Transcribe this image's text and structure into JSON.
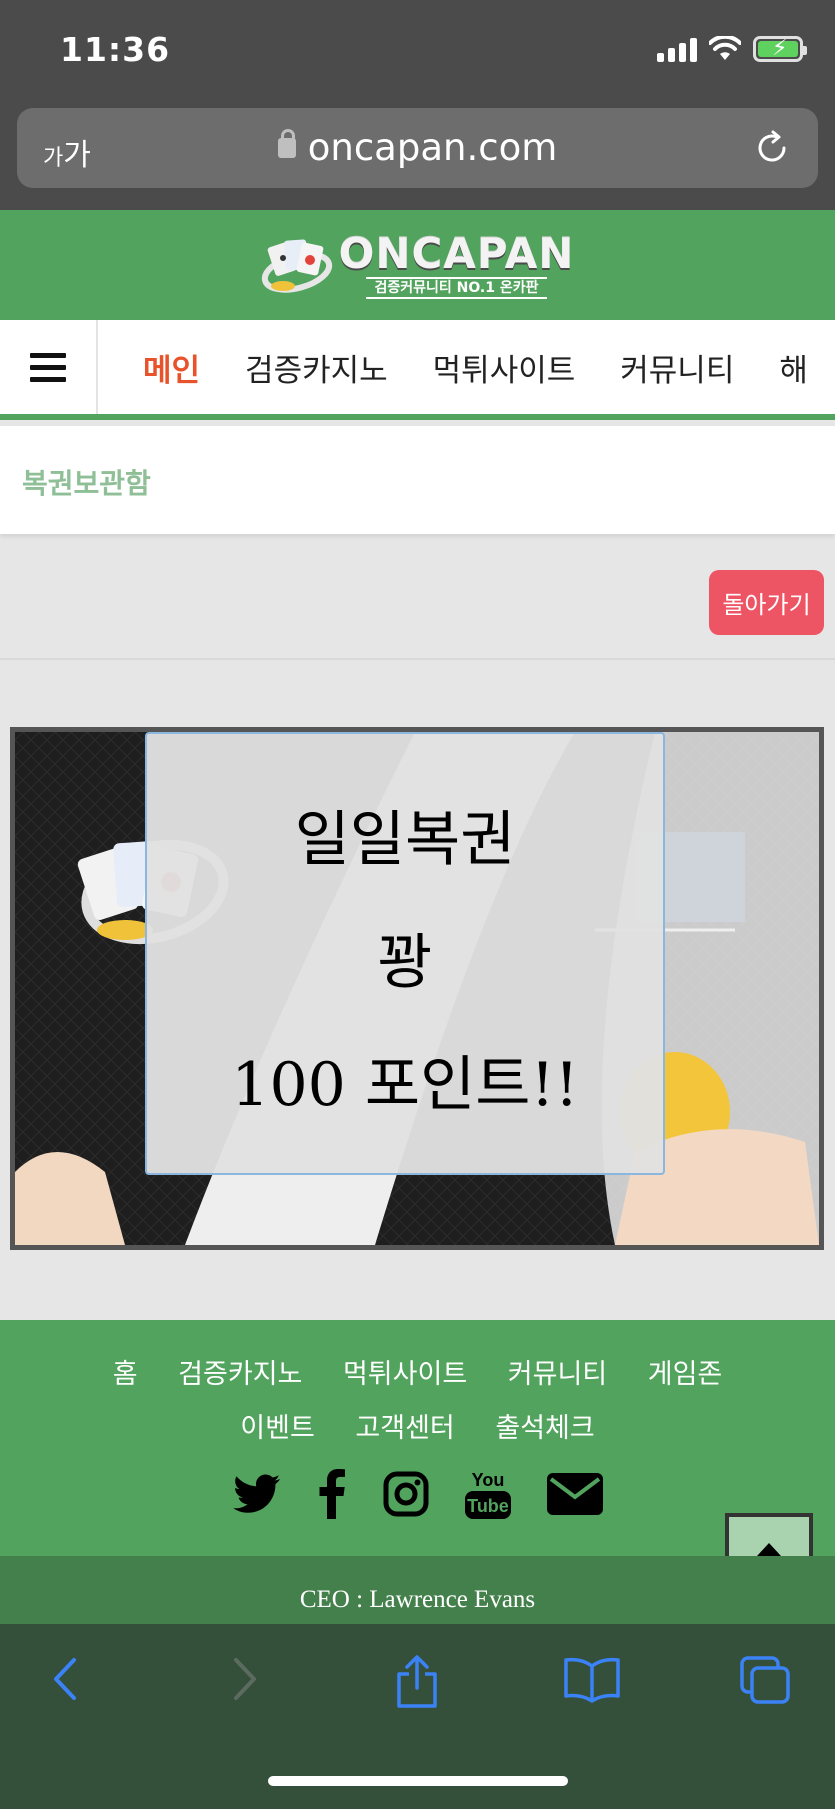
{
  "status_bar": {
    "time": "11:36"
  },
  "browser": {
    "text_size_small": "가",
    "text_size_large": "가",
    "domain": "oncapan.com"
  },
  "site": {
    "logo_title": "ONCAPAN",
    "logo_subtitle": "검증커뮤니티 NO.1 온카판"
  },
  "nav": {
    "items": [
      "메인",
      "검증카지노",
      "먹튀사이트",
      "커뮤니티",
      "해"
    ]
  },
  "page": {
    "title": "복권보관함",
    "back_button": "돌아가기"
  },
  "lottery": {
    "line1": "일일복권",
    "line2": "꽝",
    "line3": "100 포인트!!"
  },
  "footer": {
    "links": [
      "홈",
      "검증카지노",
      "먹튀사이트",
      "커뮤니티",
      "게임존",
      "이벤트",
      "고객센터",
      "출석체크"
    ],
    "social_icons": [
      "twitter-icon",
      "facebook-icon",
      "instagram-icon",
      "youtube-icon",
      "mail-icon"
    ],
    "youtube_label_top": "You",
    "youtube_label_bottom": "Tube",
    "copyright": "CEO : Lawrence Evans"
  },
  "colors": {
    "brand_green": "#51a35d",
    "active_nav": "#e8532b",
    "back_button": "#ee5564",
    "toolbar": "#34503b",
    "toolbar_icon": "#3b82f6"
  }
}
